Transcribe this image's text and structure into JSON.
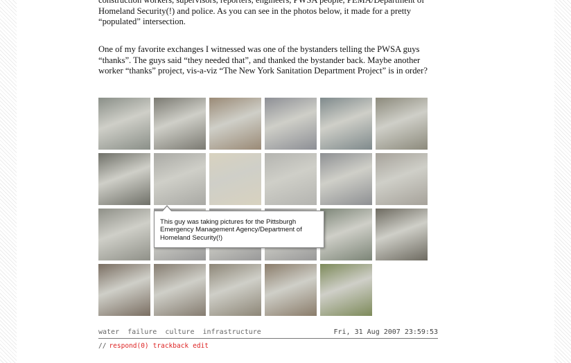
{
  "post": {
    "paragraph1": "construction workers, supervisors, reporters, engineers, PWSA people, PEMA/Department of Homeland Security(!) and police. As you can see in the photos below, it made for a pretty “populated” intersection.",
    "paragraph2": "One of my favorite exchanges I witnessed was one of the bystanders telling the PWSA guys “thanks”. The guys said “they needed that”, and thanked the bystander back. Maybe another worker “thanks” project, vis-a-viz “The New York Sanitation Department Project” is in order?"
  },
  "tooltip": {
    "text": "This guy was taking pictures for the Pittsburgh Emergency Management Agency/Department of Homeland Security(!)"
  },
  "meta": {
    "tags": [
      "water",
      "failure",
      "culture",
      "infrastructure"
    ],
    "date": "Fri, 31 Aug 2007 23:59:53"
  },
  "actions": {
    "prefix": "//",
    "respond": "respond(0)",
    "trackback": "trackback",
    "edit": "edit"
  },
  "gallery": {
    "photos": [
      {
        "name": "photo-street-view",
        "color": "#8a8f88"
      },
      {
        "name": "photo-wet-pavement",
        "color": "#7b7a72"
      },
      {
        "name": "photo-intersection-buildings",
        "color": "#9a8a76"
      },
      {
        "name": "photo-flooded-street",
        "color": "#8d8f95"
      },
      {
        "name": "photo-trucks-crowd",
        "color": "#7f8a8c"
      },
      {
        "name": "photo-man-blue-shirt",
        "color": "#8c8a7c"
      },
      {
        "name": "photo-crack-barricade",
        "color": "#6f7068"
      },
      {
        "name": "photo-cones-building",
        "color": "#a9a9a4"
      },
      {
        "name": "photo-homeland-security-seal",
        "color": "#d8d2bf"
      },
      {
        "name": "photo-van-workers",
        "color": "#b4b4b0"
      },
      {
        "name": "photo-workers-crowd",
        "color": "#8e9093"
      },
      {
        "name": "photo-white-van",
        "color": "#a6a29a"
      },
      {
        "name": "photo-street-sign",
        "color": "#8f9088"
      },
      {
        "name": "photo-obscured-1",
        "color": "#999"
      },
      {
        "name": "photo-obscured-2",
        "color": "#999"
      },
      {
        "name": "photo-obscured-3",
        "color": "#999"
      },
      {
        "name": "photo-workers-vests",
        "color": "#7c8577"
      },
      {
        "name": "photo-excavation-pit",
        "color": "#6d6a60"
      },
      {
        "name": "photo-worker-digging",
        "color": "#7a6e62"
      },
      {
        "name": "photo-rubble",
        "color": "#857c70"
      },
      {
        "name": "photo-workers-standing",
        "color": "#8d8677"
      },
      {
        "name": "photo-muddy-hole",
        "color": "#8a7c6a"
      },
      {
        "name": "photo-grass-drain",
        "color": "#7d8a5a"
      }
    ]
  }
}
